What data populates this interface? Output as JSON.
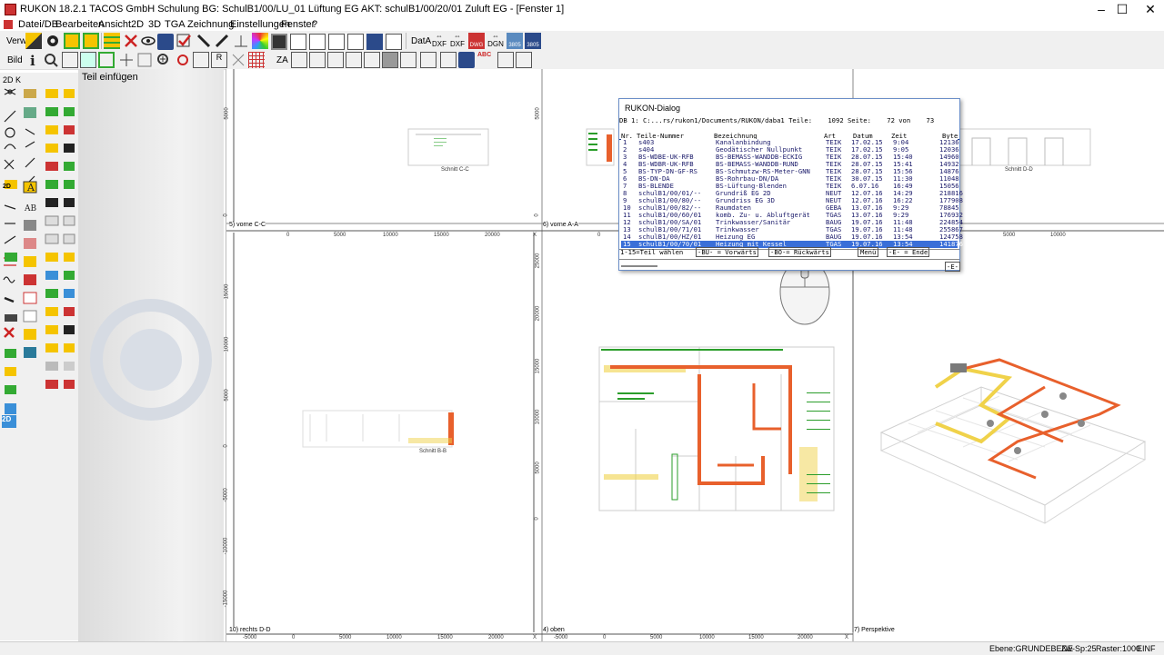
{
  "window": {
    "title": "RUKON 18.2.1  TACOS GmbH Schulung  BG: SchulB1/00/LU_01 Lüftung EG  AKT: schulB1/00/20/01 Zuluft EG - [Fenster 1]",
    "minimize": "–",
    "maximize": "☐",
    "close": "✕"
  },
  "menu": [
    "Datei/DB",
    "Bearbeiten",
    "Ansicht",
    "2D",
    "3D",
    "TGA",
    "Zeichnung",
    "Einstellungen",
    "Fenster",
    "?"
  ],
  "toolbar1": {
    "label": "Verw",
    "dxf1": "DXF",
    "dxf2": "DXF",
    "dat": "DatA",
    "dwg": "DWG",
    "dgn": "DGN",
    "vdi1": "3805",
    "vdi2": "3805"
  },
  "toolbar2": {
    "label": "Bild",
    "za": "ZA"
  },
  "palette": {
    "header": "2D K",
    "twod_a": "2D",
    "twod_b": "2D",
    "a_text": "A",
    "ab_text": "AB"
  },
  "sidepanel": {
    "title": "Teil einfügen"
  },
  "viewports": [
    {
      "label": "5) vorne C-C"
    },
    {
      "label": "6) vorne A-A"
    },
    {
      "label": "10) rechts D-D"
    },
    {
      "label": "4) oben"
    },
    {
      "label": "7) Perspektive"
    }
  ],
  "axis_ticks": {
    "top_x1": [
      "0",
      "5000",
      "10000",
      "15000",
      "20000",
      "X"
    ],
    "top_x2": [
      "0",
      "5000",
      "10000",
      "15000",
      "20000",
      "X"
    ],
    "top_x3": [
      "0",
      "5000",
      "10000"
    ],
    "bottom_x1": [
      "-5000",
      "0",
      "5000",
      "10000",
      "15000",
      "20000",
      "X"
    ],
    "bottom_x2": [
      "-5000",
      "0",
      "5000",
      "10000",
      "15000",
      "20000",
      "X"
    ],
    "left_y_top": [
      "5000",
      "0"
    ],
    "left_y_bottom": [
      "15000",
      "10000",
      "5000",
      "0",
      "-5000",
      "-10000",
      "-15000"
    ],
    "mid_y": [
      "25000",
      "20000",
      "15000",
      "10000",
      "5000",
      "0"
    ],
    "mid_y_top": [
      "5000",
      "0"
    ]
  },
  "drawing_labels": {
    "small_a": "Schnitt C-C",
    "small_b": "Schnitt B-B",
    "small_c": "Schnitt D-D"
  },
  "dialog": {
    "title": "RUKON-Dialog",
    "db_line": "DB 1: C:...rs/rukon1/Documents/RUKON/daba1 Teile:    1092 Seite:    72 von    73",
    "headers": [
      "Nr.",
      "Teile-Nummer",
      "Bezeichnung",
      "Art",
      "Datum",
      "Zeit",
      "Byte"
    ],
    "rows": [
      {
        "nr": "1",
        "teil": "s403",
        "bez": "Kanalanbindung",
        "art": "TEIK",
        "datum": "17.02.15",
        "zeit": "9:04",
        "byte": "12136"
      },
      {
        "nr": "2",
        "teil": "s404",
        "bez": "Geodätischer Nullpunkt",
        "art": "TEIK",
        "datum": "17.02.15",
        "zeit": "9:05",
        "byte": "12036"
      },
      {
        "nr": "3",
        "teil": "BS-WDBE-UK-RFB",
        "bez": "BS-BEMASS-WANDDB-ECKIG",
        "art": "TEIK",
        "datum": "28.07.15",
        "zeit": "15:40",
        "byte": "14960"
      },
      {
        "nr": "4",
        "teil": "BS-WDBR-UK-RFB",
        "bez": "BS-BEMASS-WANDDB-RUND",
        "art": "TEIK",
        "datum": "28.07.15",
        "zeit": "15:41",
        "byte": "14932"
      },
      {
        "nr": "5",
        "teil": "BS-TYP-DN-GF-RS",
        "bez": "BS-Schmutzw-RS-Meter-GNN",
        "art": "TEIK",
        "datum": "28.07.15",
        "zeit": "15:56",
        "byte": "14876"
      },
      {
        "nr": "6",
        "teil": "BS-DN-DA",
        "bez": "BS-Rohrbau-DN/DA",
        "art": "TEIK",
        "datum": "30.07.15",
        "zeit": "11:30",
        "byte": "11048"
      },
      {
        "nr": "7",
        "teil": "BS-BLENDE",
        "bez": "BS-Lüftung-Blenden",
        "art": "TEIK",
        "datum": "6.07.16",
        "zeit": "16:49",
        "byte": "15056"
      },
      {
        "nr": "8",
        "teil": "schulB1/00/01/--",
        "bez": "Grundriß EG 2D",
        "art": "NEUT",
        "datum": "12.07.16",
        "zeit": "14:29",
        "byte": "218816"
      },
      {
        "nr": "9",
        "teil": "schulB1/00/80/--",
        "bez": "Grundriss EG 3D",
        "art": "NEUT",
        "datum": "12.07.16",
        "zeit": "16:22",
        "byte": "177908"
      },
      {
        "nr": "10",
        "teil": "schulB1/00/82/--",
        "bez": "Raumdaten",
        "art": "GEBA",
        "datum": "13.07.16",
        "zeit": "9:29",
        "byte": "78845"
      },
      {
        "nr": "11",
        "teil": "schulB1/00/60/01",
        "bez": "komb. Zu- u. Abluftgerät",
        "art": "TGAS",
        "datum": "13.07.16",
        "zeit": "9:29",
        "byte": "176932"
      },
      {
        "nr": "12",
        "teil": "schulB1/00/SA/01",
        "bez": "Trinkwasser/Sanitär",
        "art": "BAUG",
        "datum": "19.07.16",
        "zeit": "11:48",
        "byte": "224854"
      },
      {
        "nr": "13",
        "teil": "schulB1/00/71/01",
        "bez": "Trinkwasser",
        "art": "TGAS",
        "datum": "19.07.16",
        "zeit": "11:48",
        "byte": "255867"
      },
      {
        "nr": "14",
        "teil": "schulB1/00/HZ/01",
        "bez": "Heizung EG",
        "art": "BAUG",
        "datum": "19.07.16",
        "zeit": "13:54",
        "byte": "124758"
      },
      {
        "nr": "15",
        "teil": "schulB1/00/70/01",
        "bez": "Heizung mit Kessel",
        "art": "TGAS",
        "datum": "19.07.16",
        "zeit": "13:54",
        "byte": "141876"
      }
    ],
    "footer": {
      "select": "1-15=Teil wählen",
      "fwd": "-BU- = Vorwärts",
      "back": "-BO-= Rückwärts",
      "menu": "Menü",
      "end": "-E- = Ende",
      "e_btn": "-E-"
    }
  },
  "status": {
    "ebene": "Ebene:GRUNDEBENE",
    "zw": "Zw-Sp:25",
    "raster": "Raster:1000.",
    "einf": "EINF"
  },
  "colors": {
    "duct_orange": "#e8602c",
    "duct_yellow": "#f0d24a",
    "dialog_header_blue": "#1f3f8f",
    "selection_blue": "#3a6fd8",
    "cad_green": "#2a9d2a"
  }
}
